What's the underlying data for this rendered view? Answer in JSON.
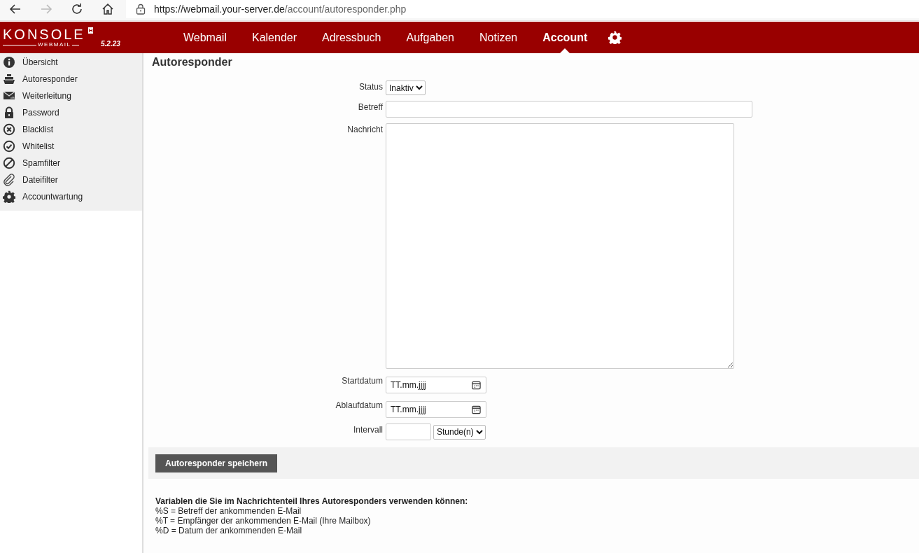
{
  "browser": {
    "url_host": "https://webmail.your-server.de",
    "url_path": "/account/autoresponder.php"
  },
  "header": {
    "logo": "KONSOLE",
    "logo_sub": "WEBMAIL",
    "logo_badge": "H",
    "version": "5.2.23",
    "nav": [
      {
        "label": "Webmail",
        "selected": false
      },
      {
        "label": "Kalender",
        "selected": false
      },
      {
        "label": "Adressbuch",
        "selected": false
      },
      {
        "label": "Aufgaben",
        "selected": false
      },
      {
        "label": "Notizen",
        "selected": false
      },
      {
        "label": "Account",
        "selected": true
      }
    ]
  },
  "sidebar": {
    "items": [
      {
        "label": "Übersicht"
      },
      {
        "label": "Autoresponder"
      },
      {
        "label": "Weiterleitung"
      },
      {
        "label": "Password"
      },
      {
        "label": "Blacklist"
      },
      {
        "label": "Whitelist"
      },
      {
        "label": "Spamfilter"
      },
      {
        "label": "Dateifilter"
      },
      {
        "label": "Accountwartung"
      }
    ]
  },
  "page": {
    "title": "Autoresponder",
    "form": {
      "status": {
        "label": "Status",
        "value": "Inaktiv"
      },
      "subject": {
        "label": "Betreff"
      },
      "message": {
        "label": "Nachricht"
      },
      "start_date": {
        "label": "Startdatum",
        "placeholder": "TT.mm.jjjj"
      },
      "end_date": {
        "label": "Ablaufdatum",
        "placeholder": "TT.mm.jjjj"
      },
      "interval": {
        "label": "Intervall",
        "unit": "Stunde(n)"
      }
    },
    "save_button": "Autoresponder speichern",
    "help": {
      "title": "Variablen die Sie im Nachrichtenteil Ihres Autoresponders verwenden können:",
      "lines": [
        "%S = Betreff der ankommenden E-Mail",
        "%T = Empfänger der ankommenden E-Mail (Ihre Mailbox)",
        "%D = Datum der ankommenden E-Mail"
      ]
    }
  }
}
